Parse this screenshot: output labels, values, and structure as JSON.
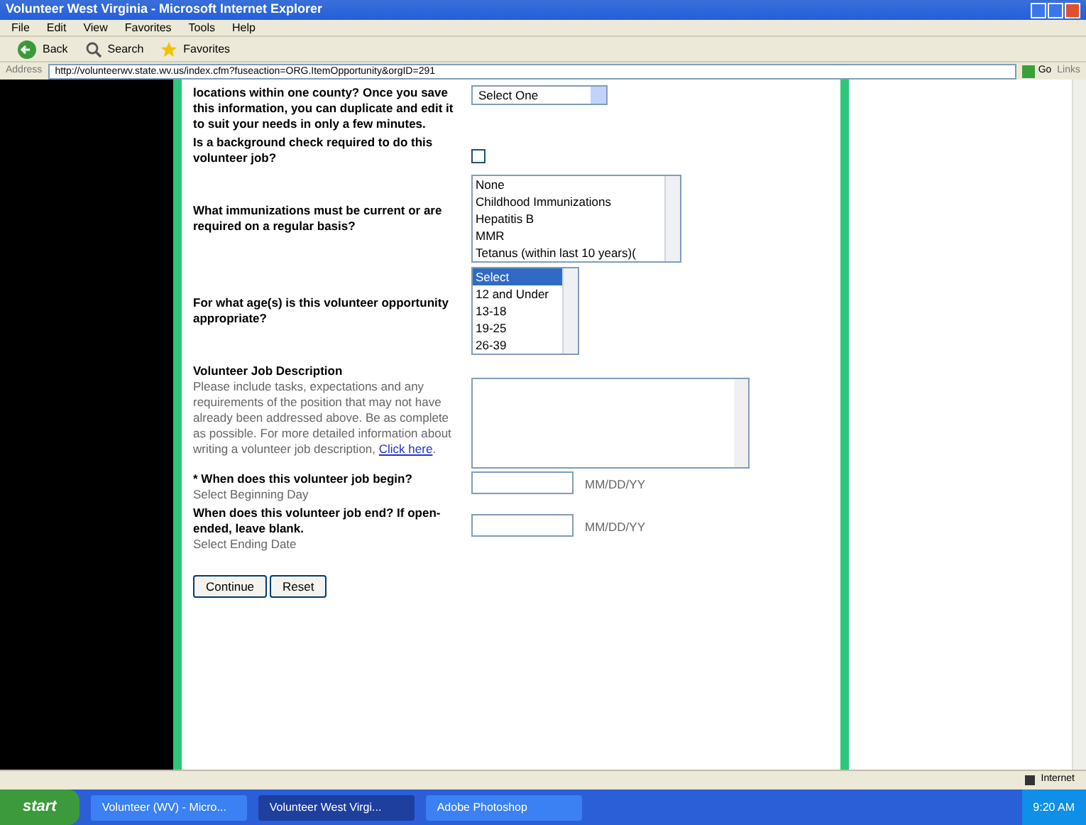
{
  "window": {
    "title": "Volunteer West Virginia - Microsoft Internet Explorer"
  },
  "menu": [
    "File",
    "Edit",
    "View",
    "Favorites",
    "Tools",
    "Help"
  ],
  "toolbar": [
    {
      "kind": "back",
      "label": "Back"
    },
    {
      "kind": "search",
      "label": "Search"
    },
    {
      "kind": "favorites",
      "label": "Favorites"
    }
  ],
  "address": {
    "label": "Address",
    "url": "http://volunteerwv.state.wv.us/index.cfm?fuseaction=ORG.ItemOpportunity&orgID=291",
    "go": "Go",
    "links": "Links"
  },
  "form": {
    "locations": {
      "label": "locations within one county? Once you save this information, you can duplicate and edit it to suit your needs in only a few minutes.",
      "select": "Select One"
    },
    "background": {
      "label": "Is a background check required to do this volunteer job?",
      "checked": false
    },
    "immunizations": {
      "label": "What immunizations must be current or are required on a regular basis?",
      "options": [
        {
          "label": "None",
          "selected": false
        },
        {
          "label": "Childhood Immunizations",
          "selected": false
        },
        {
          "label": "Hepatitis B",
          "selected": false
        },
        {
          "label": "MMR",
          "selected": false
        },
        {
          "label": "Tetanus (within last 10 years)(",
          "selected": false
        }
      ]
    },
    "ages": {
      "label": "For what age(s) is this volunteer opportunity appropriate?",
      "options": [
        {
          "label": "Select",
          "selected": true
        },
        {
          "label": "12 and Under",
          "selected": false
        },
        {
          "label": "13-18",
          "selected": false
        },
        {
          "label": "19-25",
          "selected": false
        },
        {
          "label": "26-39",
          "selected": false
        }
      ]
    },
    "description": {
      "title": "Volunteer Job Description",
      "text": "Please include tasks, expectations and any requirements of the position that may not have already been addressed above. Be as complete as possible. For more detailed information about writing a volunteer job description,",
      "link": "Click here",
      "after": "."
    },
    "begin": {
      "label": "* When does this volunteer job begin?",
      "hint": "Select Beginning Day",
      "format": "MM/DD/YY"
    },
    "end": {
      "label": "When does this volunteer job end? If open-ended, leave blank.",
      "hint": "Select Ending Date",
      "format": "MM/DD/YY"
    },
    "buttons": [
      "Continue",
      "Reset"
    ]
  },
  "status_bar": {
    "zone": "Internet"
  },
  "taskbar": {
    "start": "start",
    "tasks": [
      {
        "label": "Volunteer (WV) - Micro...",
        "selected": false
      },
      {
        "label": "Volunteer West Virgi...",
        "selected": true
      },
      {
        "label": "Adobe Photoshop",
        "selected": false
      }
    ],
    "time": "9:20 AM"
  }
}
